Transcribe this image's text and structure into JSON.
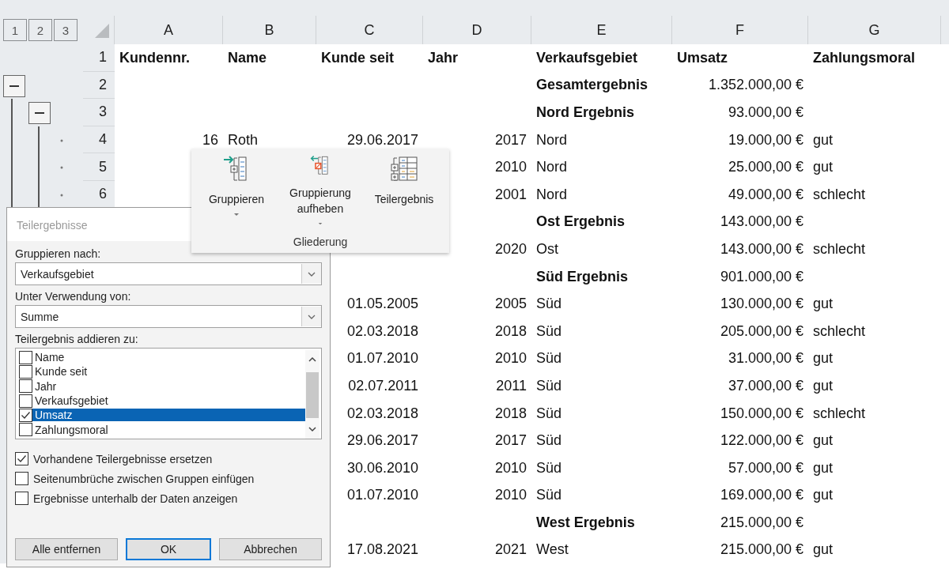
{
  "outline_levels": [
    "1",
    "2",
    "3"
  ],
  "columns": [
    "A",
    "B",
    "C",
    "D",
    "E",
    "F",
    "G"
  ],
  "rows": [
    {
      "number": "1",
      "kind": "header",
      "cells": [
        "Kundennr.",
        "Name",
        "Kunde seit",
        "Jahr",
        "Verkaufsgebiet",
        "Umsatz",
        "Zahlungsmoral"
      ]
    },
    {
      "number": "2",
      "kind": "total",
      "outline": {
        "kind": "group_1"
      },
      "cells": [
        null,
        null,
        null,
        null,
        "Gesamtergebnis",
        "1.352.000,00 €",
        null
      ]
    },
    {
      "number": "3",
      "kind": "total",
      "outline": {
        "kind": "group_2"
      },
      "cells": [
        null,
        null,
        null,
        null,
        "Nord Ergebnis",
        "93.000,00 €",
        null
      ]
    },
    {
      "number": "4",
      "kind": "data",
      "outline": {
        "kind": "detail"
      },
      "cells": [
        "16",
        "Roth",
        "29.06.2017",
        "2017",
        "Nord",
        "19.000,00 €",
        "gut"
      ]
    },
    {
      "number": "5",
      "kind": "data",
      "outline": {
        "kind": "detail"
      },
      "cells": [
        null,
        null,
        null,
        "2010",
        "Nord",
        "25.000,00 €",
        "gut"
      ]
    },
    {
      "number": "6",
      "kind": "data",
      "outline": {
        "kind": "detail"
      },
      "cells": [
        null,
        null,
        null,
        "2001",
        "Nord",
        "49.000,00 €",
        "schlecht"
      ]
    },
    {
      "kind": "total",
      "cells": [
        null,
        null,
        null,
        null,
        "Ost Ergebnis",
        "143.000,00 €",
        null
      ]
    },
    {
      "kind": "data",
      "cells": [
        null,
        null,
        null,
        "2020",
        "Ost",
        "143.000,00 €",
        "schlecht"
      ]
    },
    {
      "kind": "total",
      "cells": [
        null,
        null,
        null,
        null,
        "Süd Ergebnis",
        "901.000,00 €",
        null
      ]
    },
    {
      "kind": "data",
      "cells": [
        null,
        null,
        "01.05.2005",
        "2005",
        "Süd",
        "130.000,00 €",
        "gut"
      ]
    },
    {
      "kind": "data",
      "cells": [
        null,
        null,
        "02.03.2018",
        "2018",
        "Süd",
        "205.000,00 €",
        "schlecht"
      ]
    },
    {
      "kind": "data",
      "cells": [
        null,
        null,
        "01.07.2010",
        "2010",
        "Süd",
        "31.000,00 €",
        "gut"
      ]
    },
    {
      "kind": "data",
      "cells": [
        null,
        null,
        "02.07.2011",
        "2011",
        "Süd",
        "37.000,00 €",
        "gut"
      ]
    },
    {
      "kind": "data",
      "cells": [
        null,
        null,
        "02.03.2018",
        "2018",
        "Süd",
        "150.000,00 €",
        "schlecht"
      ]
    },
    {
      "kind": "data",
      "cells": [
        null,
        null,
        "29.06.2017",
        "2017",
        "Süd",
        "122.000,00 €",
        "gut"
      ]
    },
    {
      "kind": "data",
      "cells": [
        null,
        null,
        "30.06.2010",
        "2010",
        "Süd",
        "57.000,00 €",
        "gut"
      ]
    },
    {
      "kind": "data",
      "cells": [
        null,
        null,
        "01.07.2010",
        "2010",
        "Süd",
        "169.000,00 €",
        "gut"
      ]
    },
    {
      "kind": "total",
      "cells": [
        null,
        null,
        null,
        null,
        "West Ergebnis",
        "215.000,00 €",
        null
      ]
    },
    {
      "kind": "data",
      "cells": [
        null,
        null,
        "17.08.2021",
        "2021",
        "West",
        "215.000,00 €",
        "gut"
      ]
    }
  ],
  "ribbon": {
    "buttons": [
      {
        "kind": "group",
        "label": "Gruppieren",
        "dropdown": true
      },
      {
        "kind": "ungroup",
        "label": "Gruppierung aufheben",
        "dropdown": true
      },
      {
        "kind": "subtotal",
        "label": "Teilergebnis",
        "dropdown": false
      }
    ],
    "group_label": "Gliederung"
  },
  "dialog": {
    "title": "Teilergebnisse",
    "group_by": {
      "label": "Gruppieren nach:",
      "value": "Verkaufsgebiet"
    },
    "function": {
      "label": "Unter Verwendung von:",
      "value": "Summe"
    },
    "add_to": {
      "label": "Teilergebnis addieren zu:",
      "items": [
        {
          "label": "Name",
          "checked": false,
          "selected": false
        },
        {
          "label": "Kunde seit",
          "checked": false,
          "selected": false
        },
        {
          "label": "Jahr",
          "checked": false,
          "selected": false
        },
        {
          "label": "Verkaufsgebiet",
          "checked": false,
          "selected": false
        },
        {
          "label": "Umsatz",
          "checked": true,
          "selected": true
        },
        {
          "label": "Zahlungsmoral",
          "checked": false,
          "selected": false
        }
      ]
    },
    "options": [
      {
        "label": "Vorhandene Teilergebnisse ersetzen",
        "checked": true
      },
      {
        "label": "Seitenumbrüche zwischen Gruppen einfügen",
        "checked": false
      },
      {
        "label": "Ergebnisse unterhalb der Daten anzeigen",
        "checked": false
      }
    ],
    "buttons": [
      {
        "label": "Alle entfernen",
        "default": false
      },
      {
        "label": "OK",
        "default": true
      },
      {
        "label": "Abbrechen",
        "default": false
      }
    ]
  }
}
